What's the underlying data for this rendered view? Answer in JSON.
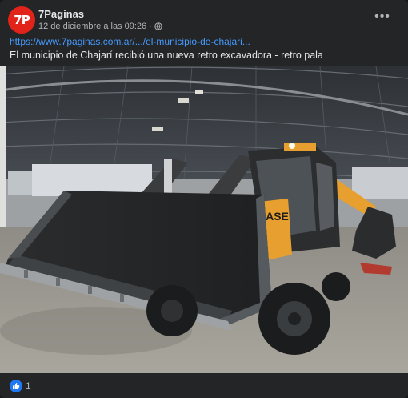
{
  "post": {
    "page_name": "7Paginas",
    "avatar_text": "7P",
    "timestamp": "12 de diciembre a las 09:26 ·",
    "more_label": "•••",
    "link_text": "https://www.7paginas.com.ar/.../el-municipio-de-chajari...",
    "caption": "El municipio de Chajarí recibió una nueva retro excavadora - retro pala",
    "image_description_icon": "backhoe-loader-photo",
    "brand_text": "CASE"
  },
  "reactions": {
    "like_icon": "thumbs-up-icon",
    "count": "1"
  },
  "colors": {
    "background": "#242526",
    "link": "#4599ff",
    "like": "#2078f4",
    "avatar": "#e2231a",
    "machine_yellow": "#e7a02f"
  }
}
